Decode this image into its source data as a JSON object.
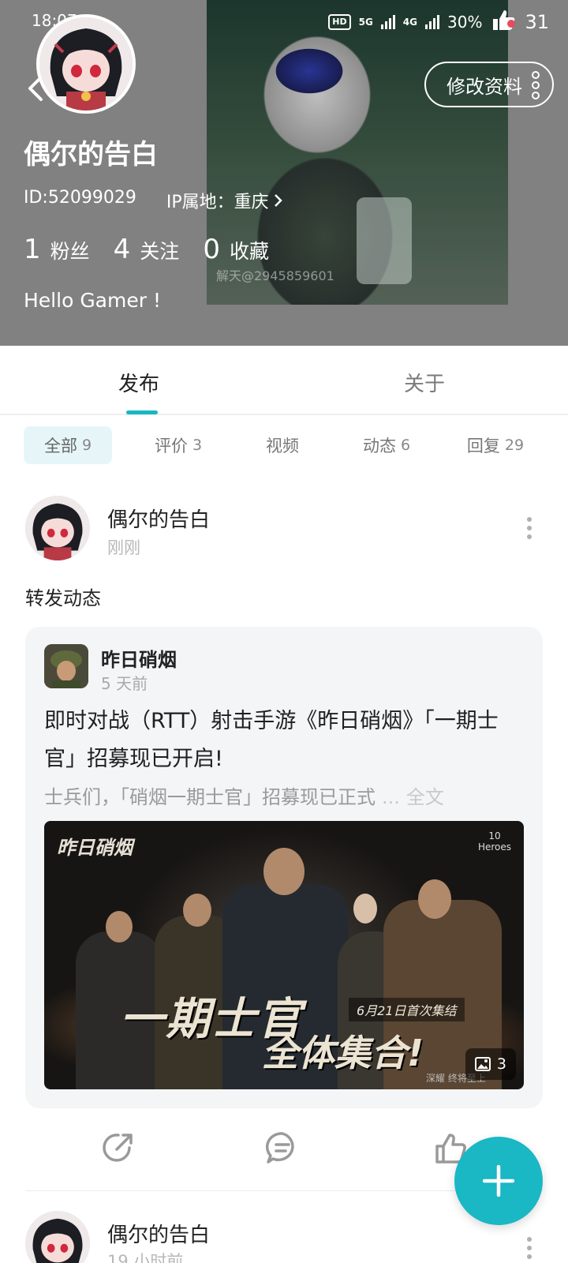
{
  "status_bar": {
    "time": "18:07",
    "network": "5G",
    "network2": "4G",
    "battery": "30%",
    "notif_count": "31"
  },
  "profile": {
    "name": "偶尔的告白",
    "id_text": "ID:52099029",
    "ip_text": "IP属地：重庆",
    "edit_label": "修改资料",
    "bio": "Hello Gamer !",
    "stats": [
      {
        "num": "1",
        "label": "粉丝"
      },
      {
        "num": "4",
        "label": "关注"
      },
      {
        "num": "0",
        "label": "收藏"
      }
    ],
    "watermark": "解天@2945859601"
  },
  "main_tabs": [
    {
      "label": "发布",
      "active": true
    },
    {
      "label": "关于",
      "active": false
    }
  ],
  "filters": [
    {
      "label": "全部",
      "count": "9",
      "active": true
    },
    {
      "label": "评价",
      "count": "3",
      "active": false
    },
    {
      "label": "视频",
      "count": "",
      "active": false
    },
    {
      "label": "动态",
      "count": "6",
      "active": false
    },
    {
      "label": "回复",
      "count": "29",
      "active": false
    }
  ],
  "post1": {
    "author": "偶尔的告白",
    "time": "刚刚",
    "text": "转发动态",
    "card": {
      "game_name": "昨日硝烟",
      "game_time": "5 天前",
      "title": "即时对战（RTT）射击手游《昨日硝烟》「一期士官」招募现已开启!",
      "excerpt": "士兵们，「硝烟一期士官」招募现已正式",
      "ellipsis": "...",
      "full_text": "全文",
      "banner": {
        "logo": "昨日硝烟",
        "brand_top": "10",
        "brand_bottom": "Heroes",
        "big1": "一期士官",
        "big2": "全体集合!",
        "date": "6月21日首次集结",
        "footer": "深耀 终将至上"
      },
      "image_count": "3"
    }
  },
  "post2": {
    "author": "偶尔的告白",
    "time": "19 小时前"
  },
  "colors": {
    "accent": "#16b8c4",
    "fab": "#1ab7c4",
    "chip_active_bg": "#e6f6f8"
  },
  "icons": {
    "back": "chevron-left-icon",
    "more": "more-vertical-icon",
    "share": "share-icon",
    "comment": "comment-icon",
    "like": "thumb-up-icon",
    "add": "plus-icon",
    "images": "image-icon"
  }
}
